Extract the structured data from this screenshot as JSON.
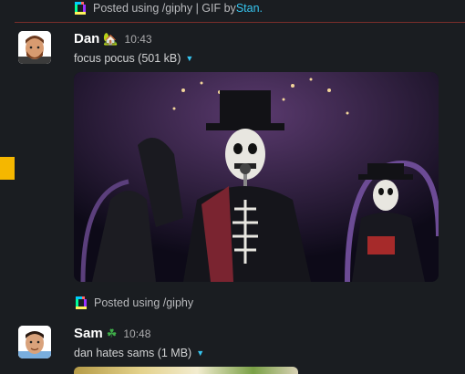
{
  "prev_attribution": {
    "text": "Posted using /giphy | GIF by ",
    "link": "Stan."
  },
  "messages": [
    {
      "author": "Dan",
      "status_emoji": "house-plant-emoji",
      "status_glyph": "🏡",
      "time": "10:43",
      "file_label": "focus pocus (501 kB)",
      "attribution": "Posted using /giphy"
    },
    {
      "author": "Sam",
      "status_emoji": "shamrock-emoji",
      "status_glyph": "☘",
      "time": "10:48",
      "file_label": "dan hates sams (1 MB)"
    }
  ],
  "colors": {
    "background": "#1a1d21",
    "link": "#36c5f0",
    "divider": "#7a2e2b",
    "marker": "#f5b700"
  }
}
